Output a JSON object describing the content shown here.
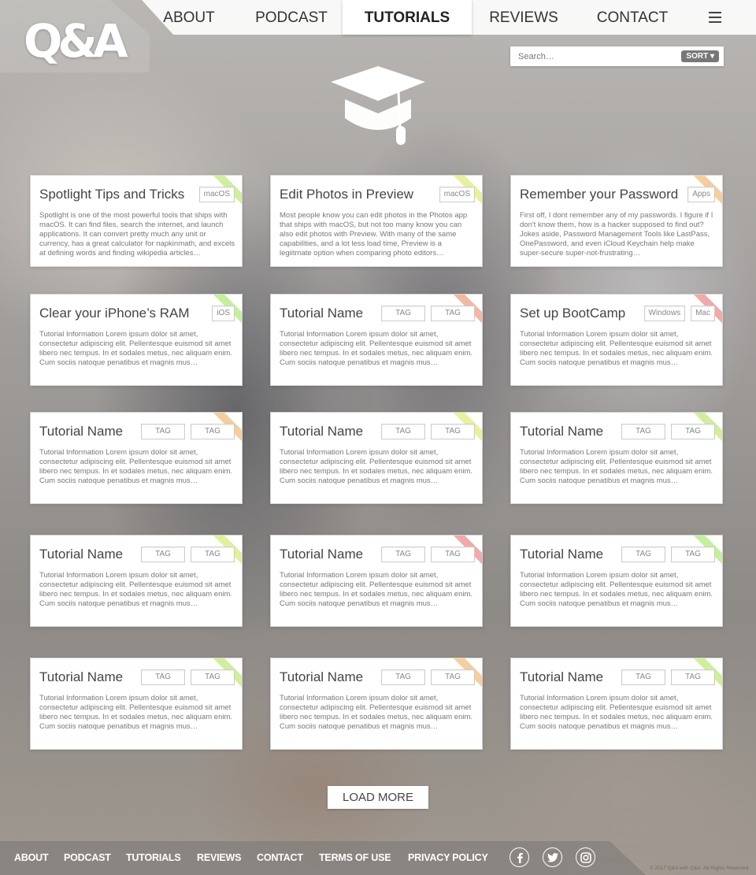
{
  "logo": {
    "text": "Q&A"
  },
  "nav": {
    "items": [
      "ABOUT",
      "PODCAST",
      "TUTORIALS",
      "REVIEWS",
      "CONTACT"
    ],
    "active": "TUTORIALS"
  },
  "search": {
    "placeholder": "Search…",
    "sort_label": "SORT ▾"
  },
  "hero": {
    "icon": "graduation-cap-icon"
  },
  "cards": [
    {
      "title": "Spotlight Tips and Tricks",
      "tags": [
        "macOS"
      ],
      "ribbon": "#c8ec8a",
      "desc": "Spotlight is one of the most powerful tools that ships with macOS. It can find files, search the internet, and launch applications. It can convert pretty much any unit or currency, has a great calculator for napkinmath, and excels at defining words and finding wikipedia articles…"
    },
    {
      "title": "Edit Photos in Preview",
      "tags": [
        "macOS"
      ],
      "ribbon": "#e6ee8a",
      "desc": "Most people know you can edit photos in the Photos app that ships with macOS, but not too many know you can also edit photos with Preview. With many of the same capabilities, and a lot less load time, Preview is a legiitmate option when comparing photo editors…"
    },
    {
      "title": "Remember your Password",
      "tags": [
        "Apps"
      ],
      "ribbon": "#f3c58c",
      "desc": "First off, I dont remember any of my passwords. I figure if I don't know them, how is a hacker supposed to find out? Jokes aside, Password Management Tools like LastPass, OnePassword, and even iCloud Keychain help make super-secure super-not-frustrating…"
    },
    {
      "title": "Clear your iPhone’s RAM",
      "tags": [
        "iOS"
      ],
      "ribbon": "#b8ee8a",
      "desc": "Tutorial Information Lorem ipsum dolor sit amet, consectetur adipiscing elit. Pellentesque euismod sit amet libero nec tempus. In et sodales metus, nec aliquam enim. Cum sociis natoque penatibus et magnis mus…"
    },
    {
      "title": "Tutorial Name",
      "tags": [
        "TAG",
        "TAG"
      ],
      "ribbon": "#f2aa92",
      "desc": "Tutorial Information Lorem ipsum dolor sit amet, consectetur adipiscing elit. Pellentesque euismod sit amet libero nec tempus. In et sodales metus, nec aliquam enim. Cum sociis natoque penatibus et magnis mus…"
    },
    {
      "title": "Set up BootCamp",
      "tags": [
        "Windows",
        "Mac"
      ],
      "ribbon": "#f09a9a",
      "desc": "Tutorial Information Lorem ipsum dolor sit amet, consectetur adipiscing elit. Pellentesque euismod sit amet libero nec tempus. In et sodales metus, nec aliquam enim. Cum sociis natoque penatibus et magnis mus…"
    },
    {
      "title": "Tutorial Name",
      "tags": [
        "TAG",
        "TAG"
      ],
      "ribbon": "#f3c58c",
      "desc": "Tutorial Information Lorem ipsum dolor sit amet, consectetur adipiscing elit. Pellentesque euismod sit amet libero nec tempus. In et sodales metus, nec aliquam enim. Cum sociis natoque penatibus et magnis mus…"
    },
    {
      "title": "Tutorial Name",
      "tags": [
        "TAG",
        "TAG"
      ],
      "ribbon": "#e6ee8a",
      "desc": "Tutorial Information Lorem ipsum dolor sit amet, consectetur adipiscing elit. Pellentesque euismod sit amet libero nec tempus. In et sodales metus, nec aliquam enim. Cum sociis natoque penatibus et magnis mus…"
    },
    {
      "title": "Tutorial Name",
      "tags": [
        "TAG",
        "TAG"
      ],
      "ribbon": "#c8ec8a",
      "desc": "Tutorial Information Lorem ipsum dolor sit amet, consectetur adipiscing elit. Pellentesque euismod sit amet libero nec tempus. In et sodales metus, nec aliquam enim. Cum sociis natoque penatibus et magnis mus…"
    },
    {
      "title": "Tutorial Name",
      "tags": [
        "TAG",
        "TAG"
      ],
      "ribbon": "#dcee8a",
      "desc": "Tutorial Information Lorem ipsum dolor sit amet, consectetur adipiscing elit. Pellentesque euismod sit amet libero nec tempus. In et sodales metus, nec aliquam enim. Cum sociis natoque penatibus et magnis mus…"
    },
    {
      "title": "Tutorial Name",
      "tags": [
        "TAG",
        "TAG"
      ],
      "ribbon": "#f09a9a",
      "desc": "Tutorial Information Lorem ipsum dolor sit amet, consectetur adipiscing elit. Pellentesque euismod sit amet libero nec tempus. In et sodales metus, nec aliquam enim. Cum sociis natoque penatibus et magnis mus…"
    },
    {
      "title": "Tutorial Name",
      "tags": [
        "TAG",
        "TAG"
      ],
      "ribbon": "#b8ee8a",
      "desc": "Tutorial Information Lorem ipsum dolor sit amet, consectetur adipiscing elit. Pellentesque euismod sit amet libero nec tempus. In et sodales metus, nec aliquam enim. Cum sociis natoque penatibus et magnis mus…"
    },
    {
      "title": "Tutorial Name",
      "tags": [
        "TAG",
        "TAG"
      ],
      "ribbon": "#c8ec8a",
      "desc": "Tutorial Information Lorem ipsum dolor sit amet, consectetur adipiscing elit. Pellentesque euismod sit amet libero nec tempus. In et sodales metus, nec aliquam enim. Cum sociis natoque penatibus et magnis mus…"
    },
    {
      "title": "Tutorial Name",
      "tags": [
        "TAG",
        "TAG"
      ],
      "ribbon": "#f3c58c",
      "desc": "Tutorial Information Lorem ipsum dolor sit amet, consectetur adipiscing elit. Pellentesque euismod sit amet libero nec tempus. In et sodales metus, nec aliquam enim. Cum sociis natoque penatibus et magnis mus…"
    },
    {
      "title": "Tutorial Name",
      "tags": [
        "TAG",
        "TAG"
      ],
      "ribbon": "#c8ec8a",
      "desc": "Tutorial Information Lorem ipsum dolor sit amet, consectetur adipiscing elit. Pellentesque euismod sit amet libero nec tempus. In et sodales metus, nec aliquam enim. Cum sociis natoque penatibus et magnis mus…"
    }
  ],
  "load_more": "LOAD MORE",
  "footer": {
    "links": [
      "ABOUT",
      "PODCAST",
      "TUTORIALS",
      "REVIEWS",
      "CONTACT",
      "TERMS OF USE",
      "PRIVACY POLICY"
    ],
    "social": [
      "facebook-icon",
      "twitter-icon",
      "instagram-icon"
    ],
    "copyright": "© 2017 Q&A with Q&A. All Rights Reserved."
  },
  "colors": {
    "active_nav": "#ffffff",
    "text": "#444444",
    "tag_border": "#cccccc"
  }
}
